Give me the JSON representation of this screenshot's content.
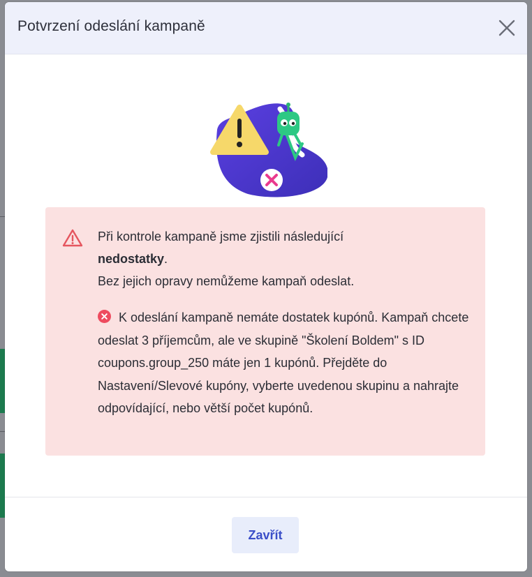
{
  "modal": {
    "title": "Potvrzení odeslání kampaně",
    "close_icon": "close-icon",
    "illustration_icon": "warning-robot-illustration"
  },
  "alert": {
    "icon": "warning-triangle-icon",
    "line1": "Při kontrole kampaně jsme zjistili následující",
    "line2_bold": "nedostatky",
    "line2_rest": ".",
    "line3": "Bez jejich opravy nemůžeme kampaň odeslat.",
    "error_icon": "error-circle-icon",
    "error_message": "K odeslání kampaně nemáte dostatek kupónů. Kampaň chcete odeslat 3 příjemcům, ale ve skupině \"Školení Boldem\" s ID coupons.group_250 máte jen 1 kupónů. Přejděte do Nastavení/Slevové kupóny, vyberte uvedenou skupinu a nahrajte odpovídající, nebo větší počet kupónů."
  },
  "footer": {
    "close_button_label": "Zavřít"
  },
  "colors": {
    "header_bg": "#eef0fb",
    "alert_bg": "#fbe1e1",
    "accent": "#3a4ec8",
    "error": "#ee4b5f"
  }
}
